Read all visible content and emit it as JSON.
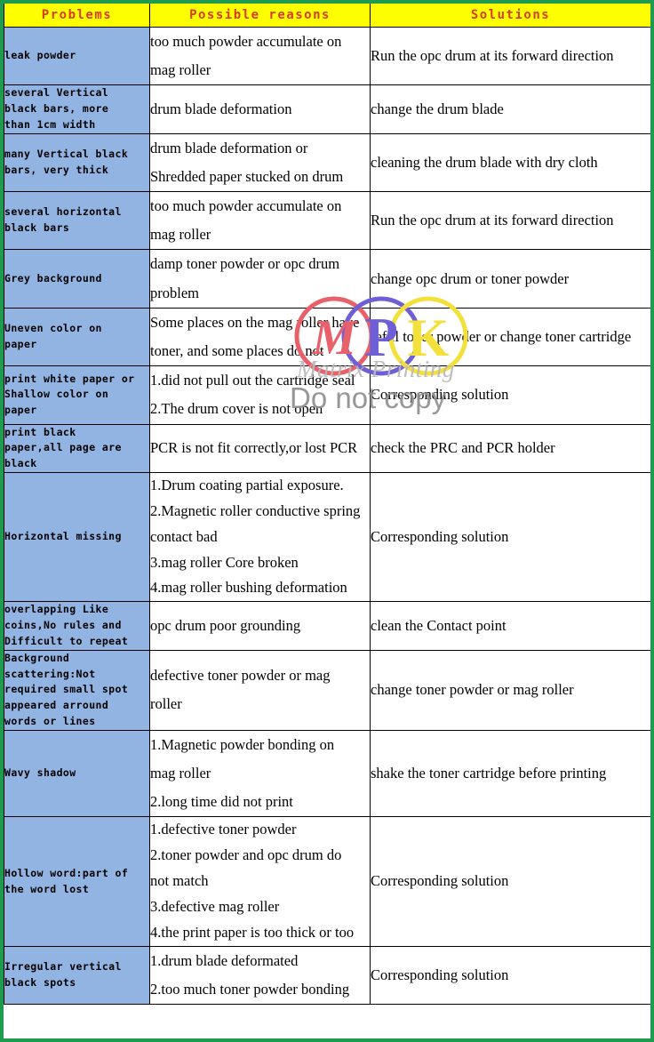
{
  "document": {
    "kind": "troubleshooting-table",
    "border_color": "#1f9b4f",
    "header_background": "#ffff00",
    "header_text_color": "#d93b18",
    "problem_column_background": "#92b4e3"
  },
  "watermark": {
    "logo_letters": [
      "M",
      "P",
      "K"
    ],
    "logo_colors": [
      "#e8616a",
      "#6f5fd6",
      "#f4e03a"
    ],
    "line1": "Matrix Printing",
    "line2": "Do not copy"
  },
  "table": {
    "headers": [
      "Problems",
      "Possible reasons",
      "Solutions"
    ],
    "rows": [
      {
        "problem": [
          "leak powder"
        ],
        "reasons": [
          "too much powder accumulate on",
          "mag roller"
        ],
        "solutions": [
          "Run the opc drum at its forward direction"
        ]
      },
      {
        "problem": [
          "several Vertical",
          "black bars, more",
          "than 1cm width"
        ],
        "reasons": [
          "drum blade deformation"
        ],
        "solutions": [
          "change the drum blade"
        ]
      },
      {
        "problem": [
          "many Vertical black",
          "bars, very thick"
        ],
        "reasons": [
          "drum blade deformation or",
          "Shredded paper stucked on drum"
        ],
        "solutions": [
          "cleaning the drum blade with dry cloth"
        ]
      },
      {
        "problem": [
          "several horizontal",
          "black bars"
        ],
        "reasons": [
          "too much powder accumulate on",
          "mag roller"
        ],
        "solutions": [
          "Run the opc drum at its forward direction"
        ]
      },
      {
        "problem": [
          "Grey background"
        ],
        "reasons": [
          "damp toner powder or opc drum",
          "problem"
        ],
        "solutions": [
          "change opc drum or toner powder"
        ]
      },
      {
        "problem": [
          "Uneven color on",
          "paper"
        ],
        "reasons": [
          "Some places on the mag roller have",
          "toner, and some places do not"
        ],
        "solutions": [
          "refill toner powder or change toner cartridge"
        ]
      },
      {
        "problem": [
          "print white paper or",
          "Shallow color on",
          "paper"
        ],
        "reasons": [
          "1.did not pull out the cartridge seal",
          "2.The drum cover is not open"
        ],
        "solutions": [
          "Corresponding solution"
        ]
      },
      {
        "problem": [
          "print black",
          "paper,all page are",
          "black"
        ],
        "reasons": [
          "PCR is not fit correctly,or lost PCR"
        ],
        "solutions": [
          "check the PRC and PCR holder"
        ]
      },
      {
        "problem": [
          "Horizontal missing"
        ],
        "reasons": [
          "1.Drum coating partial exposure.",
          "2.Magnetic roller conductive spring",
          "contact bad",
          "3.mag roller Core broken",
          "4.mag roller bushing deformation"
        ],
        "solutions": [
          "Corresponding solution"
        ]
      },
      {
        "problem": [
          "overlapping Like",
          "coins,No rules and",
          "Difficult to repeat"
        ],
        "reasons": [
          "opc drum poor grounding"
        ],
        "solutions": [
          "clean the Contact point"
        ]
      },
      {
        "problem": [
          "Background",
          "scattering:Not",
          "required small spot",
          "appeared  arround",
          "words or lines"
        ],
        "reasons": [
          "defective toner powder or mag",
          "roller"
        ],
        "solutions": [
          "change toner powder or mag roller"
        ]
      },
      {
        "problem": [
          "Wavy shadow"
        ],
        "reasons": [
          "1.Magnetic powder bonding on",
          "mag roller",
          "2.long time did not print"
        ],
        "solutions": [
          "shake the toner cartridge before printing"
        ]
      },
      {
        "problem": [
          "Hollow word:part of",
          "the word lost"
        ],
        "reasons": [
          "1.defective toner powder",
          "2.toner powder and opc drum do",
          "not match",
          "3.defective mag roller",
          "4.the print paper is too thick or too"
        ],
        "solutions": [
          "Corresponding solution"
        ]
      },
      {
        "problem": [
          "Irregular vertical",
          "black spots"
        ],
        "reasons": [
          "1.drum blade deformated",
          "2.too much toner powder bonding"
        ],
        "solutions": [
          "Corresponding solution"
        ]
      }
    ]
  }
}
